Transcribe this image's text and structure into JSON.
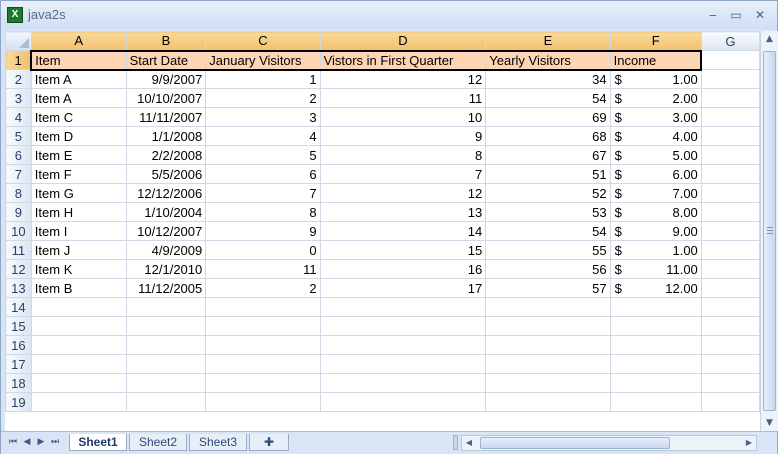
{
  "window": {
    "title": "java2s",
    "app_icon": "excel-icon"
  },
  "columns": [
    "A",
    "B",
    "C",
    "D",
    "E",
    "F",
    "G"
  ],
  "header_row": [
    "Item",
    "Start Date",
    "January Visitors",
    "Vistors in First Quarter",
    "Yearly Visitors",
    "Income"
  ],
  "rows": [
    [
      "Item A",
      "9/9/2007",
      "1",
      "12",
      "34",
      "$",
      "1.00"
    ],
    [
      "Item A",
      "10/10/2007",
      "2",
      "11",
      "54",
      "$",
      "2.00"
    ],
    [
      "Item C",
      "11/11/2007",
      "3",
      "10",
      "69",
      "$",
      "3.00"
    ],
    [
      "Item D",
      "1/1/2008",
      "4",
      "9",
      "68",
      "$",
      "4.00"
    ],
    [
      "Item E",
      "2/2/2008",
      "5",
      "8",
      "67",
      "$",
      "5.00"
    ],
    [
      "Item F",
      "5/5/2006",
      "6",
      "7",
      "51",
      "$",
      "6.00"
    ],
    [
      "Item G",
      "12/12/2006",
      "7",
      "12",
      "52",
      "$",
      "7.00"
    ],
    [
      "Item H",
      "1/10/2004",
      "8",
      "13",
      "53",
      "$",
      "8.00"
    ],
    [
      "Item I",
      "10/12/2007",
      "9",
      "14",
      "54",
      "$",
      "9.00"
    ],
    [
      "Item J",
      "4/9/2009",
      "0",
      "15",
      "55",
      "$",
      "1.00"
    ],
    [
      "Item K",
      "12/1/2010",
      "11",
      "16",
      "56",
      "$",
      "11.00"
    ],
    [
      "Item B",
      "11/12/2005",
      "2",
      "17",
      "57",
      "$",
      "12.00"
    ]
  ],
  "row_numbers": [
    "1",
    "2",
    "3",
    "4",
    "5",
    "6",
    "7",
    "8",
    "9",
    "10",
    "11",
    "12",
    "13",
    "14",
    "15",
    "16",
    "17",
    "18",
    "19"
  ],
  "sheet_tabs": [
    "Sheet1",
    "Sheet2",
    "Sheet3"
  ],
  "active_sheet": "Sheet1",
  "colors": {
    "header_fill": "#fcd5b4",
    "selected_header": "#f3c06b"
  }
}
